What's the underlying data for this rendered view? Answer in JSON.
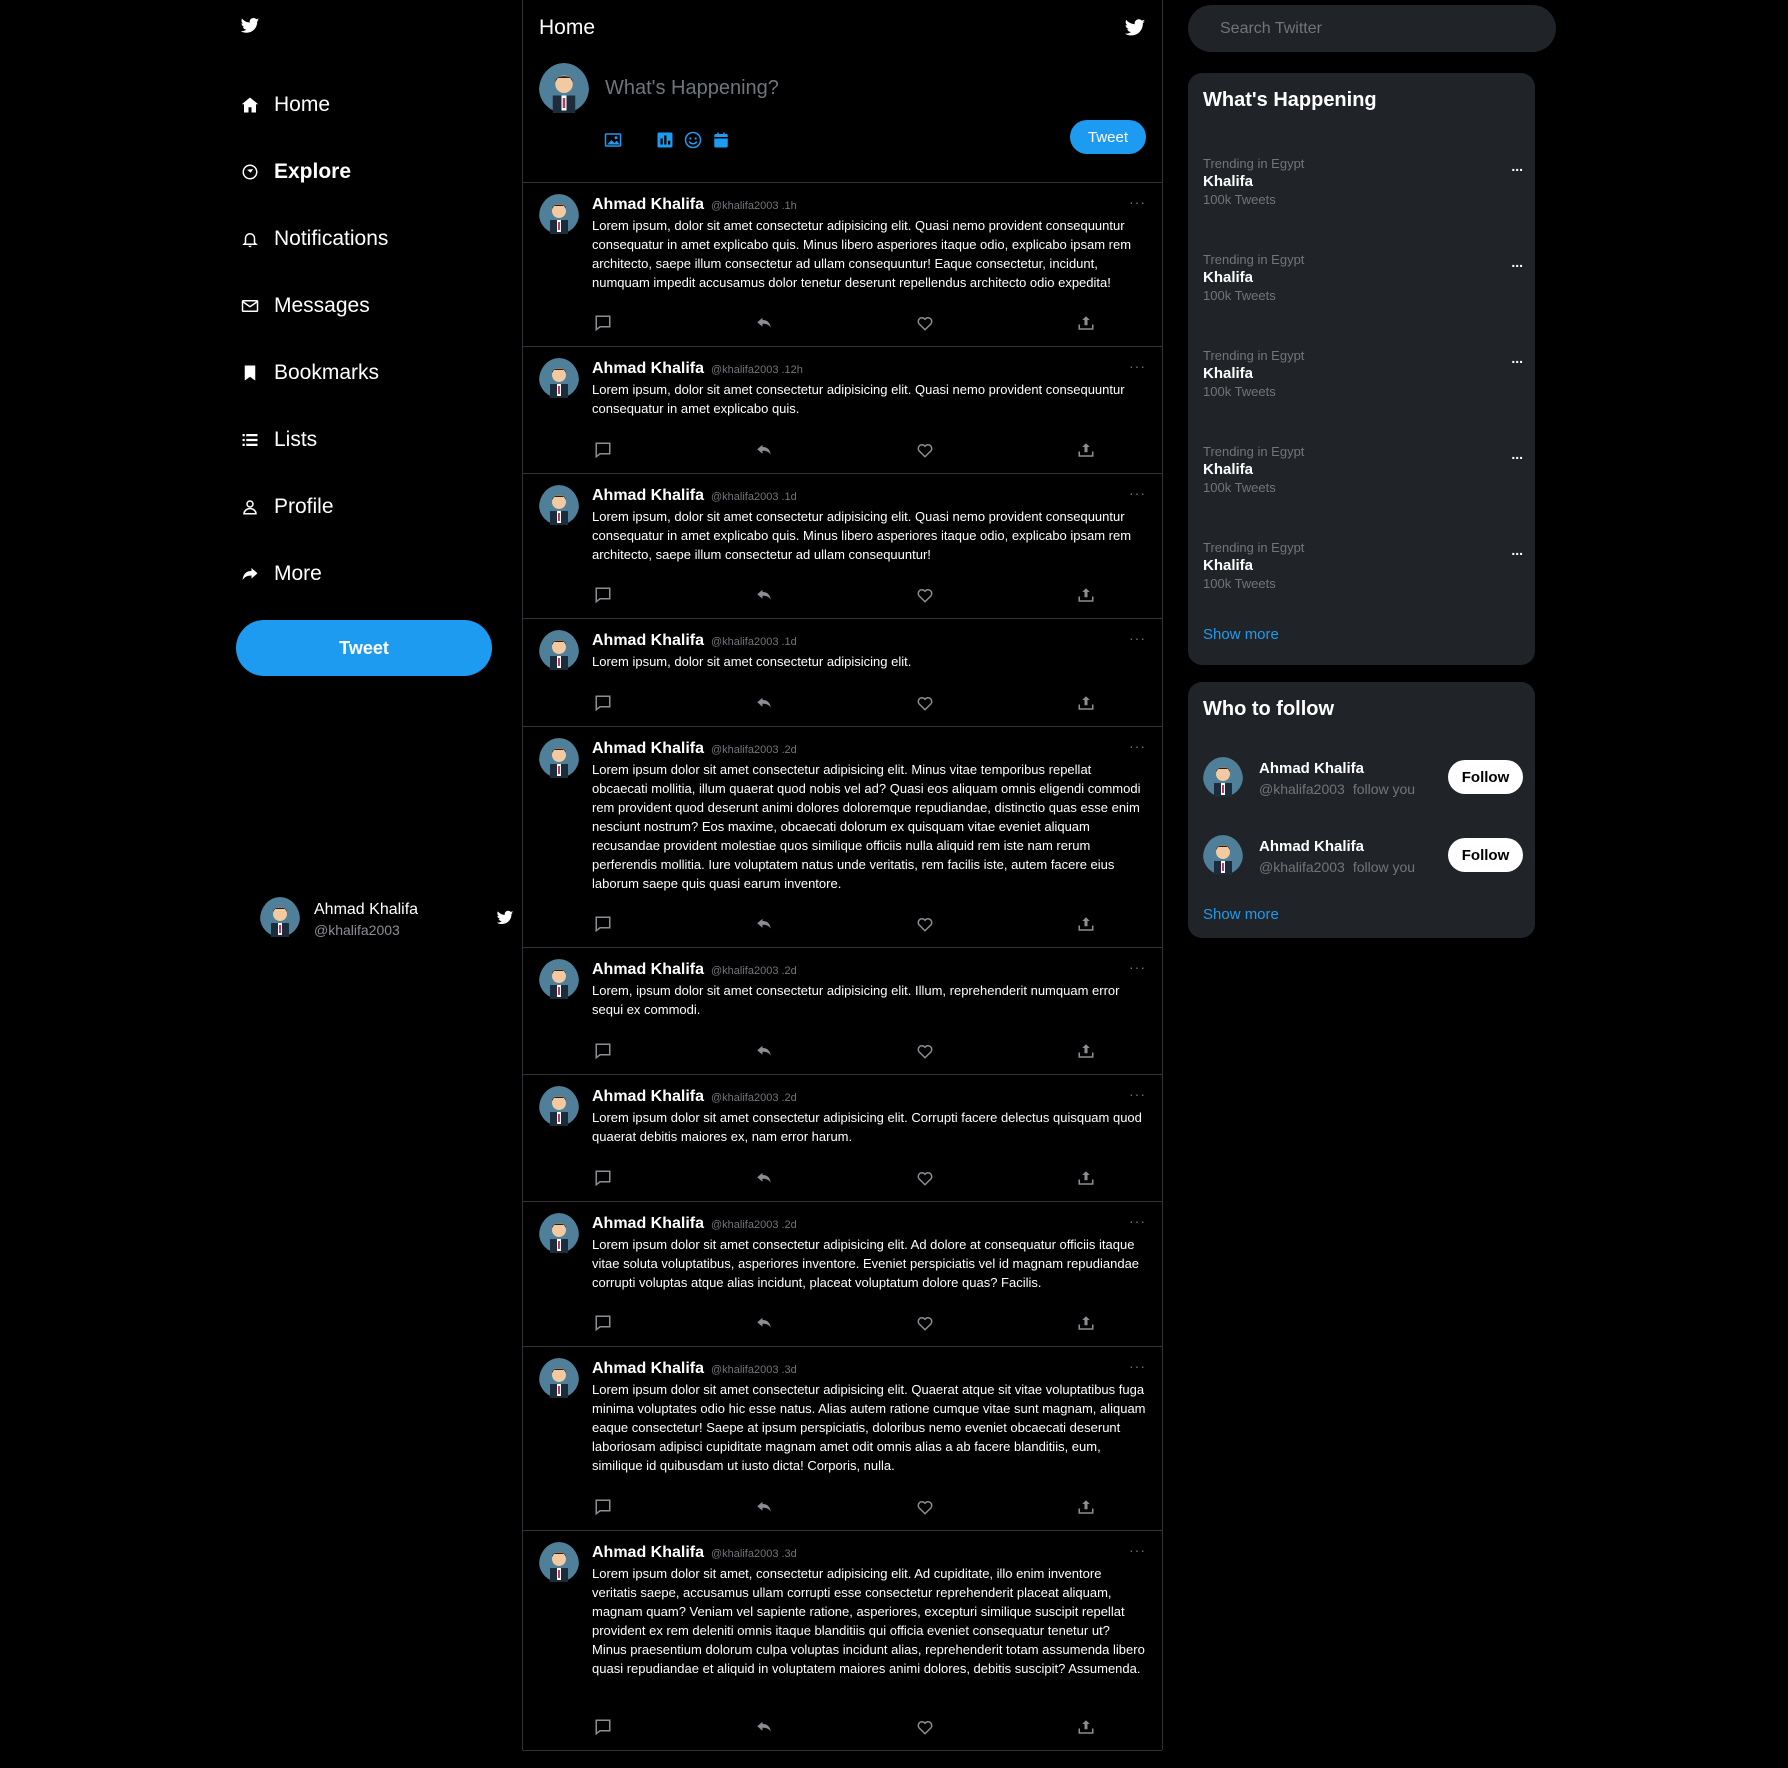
{
  "sidebar": {
    "nav": [
      {
        "label": "Home",
        "icon": "home-icon"
      },
      {
        "label": "Explore",
        "icon": "explore-icon"
      },
      {
        "label": "Notifications",
        "icon": "bell-icon"
      },
      {
        "label": "Messages",
        "icon": "envelope-icon"
      },
      {
        "label": "Bookmarks",
        "icon": "bookmark-icon"
      },
      {
        "label": "Lists",
        "icon": "list-icon"
      },
      {
        "label": "Profile",
        "icon": "user-icon"
      },
      {
        "label": "More",
        "icon": "share-icon"
      }
    ],
    "tweet_button": "Tweet",
    "account": {
      "name": "Ahmad Khalifa",
      "handle": "@khalifa2003"
    }
  },
  "feed": {
    "title": "Home",
    "composer": {
      "placeholder": "What's Happening?",
      "tweet_button": "Tweet"
    },
    "tweets": [
      {
        "author": "Ahmad Khalifa",
        "meta": "@khalifa2003 .1h",
        "text": "Lorem ipsum, dolor sit amet consectetur adipisicing elit. Quasi nemo provident consequuntur consequatur in amet explicabo quis. Minus libero asperiores itaque odio, explicabo ipsam rem architecto, saepe illum consectetur ad ullam consequuntur! Eaque consectetur, incidunt, numquam impedit accusamus dolor tenetur deserunt repellendus architecto odio expedita!"
      },
      {
        "author": "Ahmad Khalifa",
        "meta": "@khalifa2003 .12h",
        "text": "Lorem ipsum, dolor sit amet consectetur adipisicing elit. Quasi nemo provident consequuntur consequatur in amet explicabo quis."
      },
      {
        "author": "Ahmad Khalifa",
        "meta": "@khalifa2003 .1d",
        "text": "Lorem ipsum, dolor sit amet consectetur adipisicing elit. Quasi nemo provident consequuntur consequatur in amet explicabo quis. Minus libero asperiores itaque odio, explicabo ipsam rem architecto, saepe illum consectetur ad ullam consequuntur!"
      },
      {
        "author": "Ahmad Khalifa",
        "meta": "@khalifa2003 .1d",
        "text": "Lorem ipsum, dolor sit amet consectetur adipisicing elit."
      },
      {
        "author": "Ahmad Khalifa",
        "meta": "@khalifa2003 .2d",
        "text": "Lorem ipsum dolor sit amet consectetur adipisicing elit. Minus vitae temporibus repellat obcaecati mollitia, illum quaerat quod nobis vel ad? Quasi eos aliquam omnis eligendi commodi rem provident quod deserunt animi dolores doloremque repudiandae, distinctio quas esse enim nesciunt nostrum? Eos maxime, obcaecati dolorum ex quisquam vitae eveniet aliquam recusandae provident molestiae quos similique officiis nulla aliquid rem iste nam rerum perferendis mollitia. Iure voluptatem natus unde veritatis, rem facilis iste, autem facere eius laborum saepe quis quasi earum inventore."
      },
      {
        "author": "Ahmad Khalifa",
        "meta": "@khalifa2003 .2d",
        "text": "Lorem, ipsum dolor sit amet consectetur adipisicing elit. Illum, reprehenderit numquam error sequi ex commodi."
      },
      {
        "author": "Ahmad Khalifa",
        "meta": "@khalifa2003 .2d",
        "text": "Lorem ipsum dolor sit amet consectetur adipisicing elit. Corrupti facere delectus quisquam quod quaerat debitis maiores ex, nam error harum."
      },
      {
        "author": "Ahmad Khalifa",
        "meta": "@khalifa2003 .2d",
        "text": "Lorem ipsum dolor sit amet consectetur adipisicing elit. Ad dolore at consequatur officiis itaque vitae soluta voluptatibus, asperiores inventore. Eveniet perspiciatis vel id magnam repudiandae corrupti voluptas atque alias incidunt, placeat voluptatum dolore quas? Facilis."
      },
      {
        "author": "Ahmad Khalifa",
        "meta": "@khalifa2003 .3d",
        "text": "Lorem ipsum dolor sit amet consectetur adipisicing elit. Quaerat atque sit vitae voluptatibus fuga minima voluptates odio hic esse natus. Alias autem ratione cumque vitae sunt magnam, aliquam eaque consectetur! Saepe at ipsum perspiciatis, doloribus nemo eveniet obcaecati deserunt laboriosam adipisci cupiditate magnam amet odit omnis alias a ab facere blanditiis, eum, similique id quibusdam ut iusto dicta! Corporis, nulla."
      },
      {
        "author": "Ahmad Khalifa",
        "meta": "@khalifa2003 .3d",
        "text": "Lorem ipsum dolor sit amet, consectetur adipisicing elit. Ad cupiditate, illo enim inventore veritatis saepe, accusamus ullam corrupti esse consectetur reprehenderit placeat aliquam, magnam quam? Veniam vel sapiente ratione, asperiores, excepturi similique suscipit repellat provident ex rem deleniti omnis itaque blanditiis qui officia eveniet consequatur tenetur ut? Minus praesentium dolorum culpa voluptas incidunt alias, reprehenderit totam assumenda libero quasi repudiandae et aliquid in voluptatem maiores animi dolores, debitis suscipit? Assumenda."
      }
    ]
  },
  "right": {
    "search_placeholder": "Search Twitter",
    "happening": {
      "title": "What's Happening",
      "more_glyph": "...",
      "trends": [
        {
          "context": "Trending in Egypt",
          "name": "Khalifa",
          "count": "100k Tweets"
        },
        {
          "context": "Trending in Egypt",
          "name": "Khalifa",
          "count": "100k Tweets"
        },
        {
          "context": "Trending in Egypt",
          "name": "Khalifa",
          "count": "100k Tweets"
        },
        {
          "context": "Trending in Egypt",
          "name": "Khalifa",
          "count": "100k Tweets"
        },
        {
          "context": "Trending in Egypt",
          "name": "Khalifa",
          "count": "100k Tweets"
        }
      ],
      "show_more": "Show more"
    },
    "who_to_follow": {
      "title": "Who to follow",
      "users": [
        {
          "name": "Ahmad Khalifa",
          "handle": "@khalifa2003",
          "note": "follow you",
          "button": "Follow"
        },
        {
          "name": "Ahmad Khalifa",
          "handle": "@khalifa2003",
          "note": "follow you",
          "button": "Follow"
        }
      ],
      "show_more": "Show more"
    }
  },
  "colors": {
    "accent": "#1d9bf0",
    "panel": "#202327",
    "divider": "#2f3336",
    "muted": "#71767b"
  }
}
